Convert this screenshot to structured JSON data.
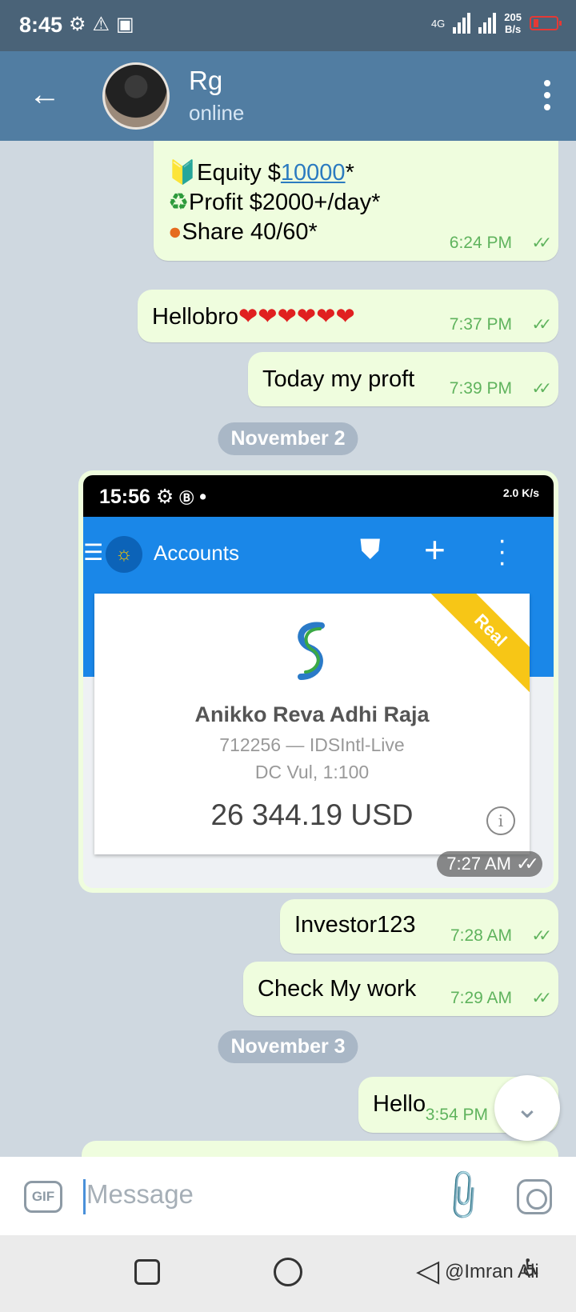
{
  "status_bar": {
    "time": "8:45",
    "network": "4G",
    "speed_value": "205",
    "speed_unit": "B/s",
    "battery_level": "4"
  },
  "header": {
    "name": "Rg",
    "status": "online"
  },
  "messages": {
    "m1": {
      "equity_prefix": "Equity $",
      "equity_link": "10000",
      "equity_suffix": "*",
      "profit": "Profit $2000+/day*",
      "share": "Share 40/60*",
      "time": "6:24 PM",
      "ticks": "✓✓"
    },
    "m2": {
      "text": "Hellobro",
      "hearts": "❤❤❤❤❤❤",
      "time": "7:37 PM",
      "ticks": "✓✓"
    },
    "m3": {
      "text": "Today my proft",
      "time": "7:39 PM",
      "ticks": "✓✓"
    },
    "date1": "November 2",
    "photo": {
      "time": "7:27 AM",
      "ticks": "✓✓",
      "inner_time": "15:56",
      "inner_status": "2.0 K/s",
      "app_title": "Accounts",
      "ribbon": "Real",
      "account_name": "Anikko Reva Adhi Raja",
      "account_line1": "712256 — IDSIntl-Live",
      "account_line2": "DC Vul, 1:100",
      "balance": "26 344.19 USD"
    },
    "m5": {
      "text": "Investor123",
      "time": "7:28 AM",
      "ticks": "✓✓"
    },
    "m6": {
      "text": "Check My work",
      "time": "7:29 AM",
      "ticks": "✓✓"
    },
    "date2": "November 3",
    "m7": {
      "text": "Hello",
      "time": "3:54 PM"
    }
  },
  "input": {
    "placeholder": "Message",
    "gif_label": "GIF"
  },
  "watermark": "@Imran Ali",
  "colors": {
    "header": "#517da2",
    "bubble_out": "#effdde",
    "chat_bg": "#cfd8e0",
    "check": "#5fb35d"
  }
}
